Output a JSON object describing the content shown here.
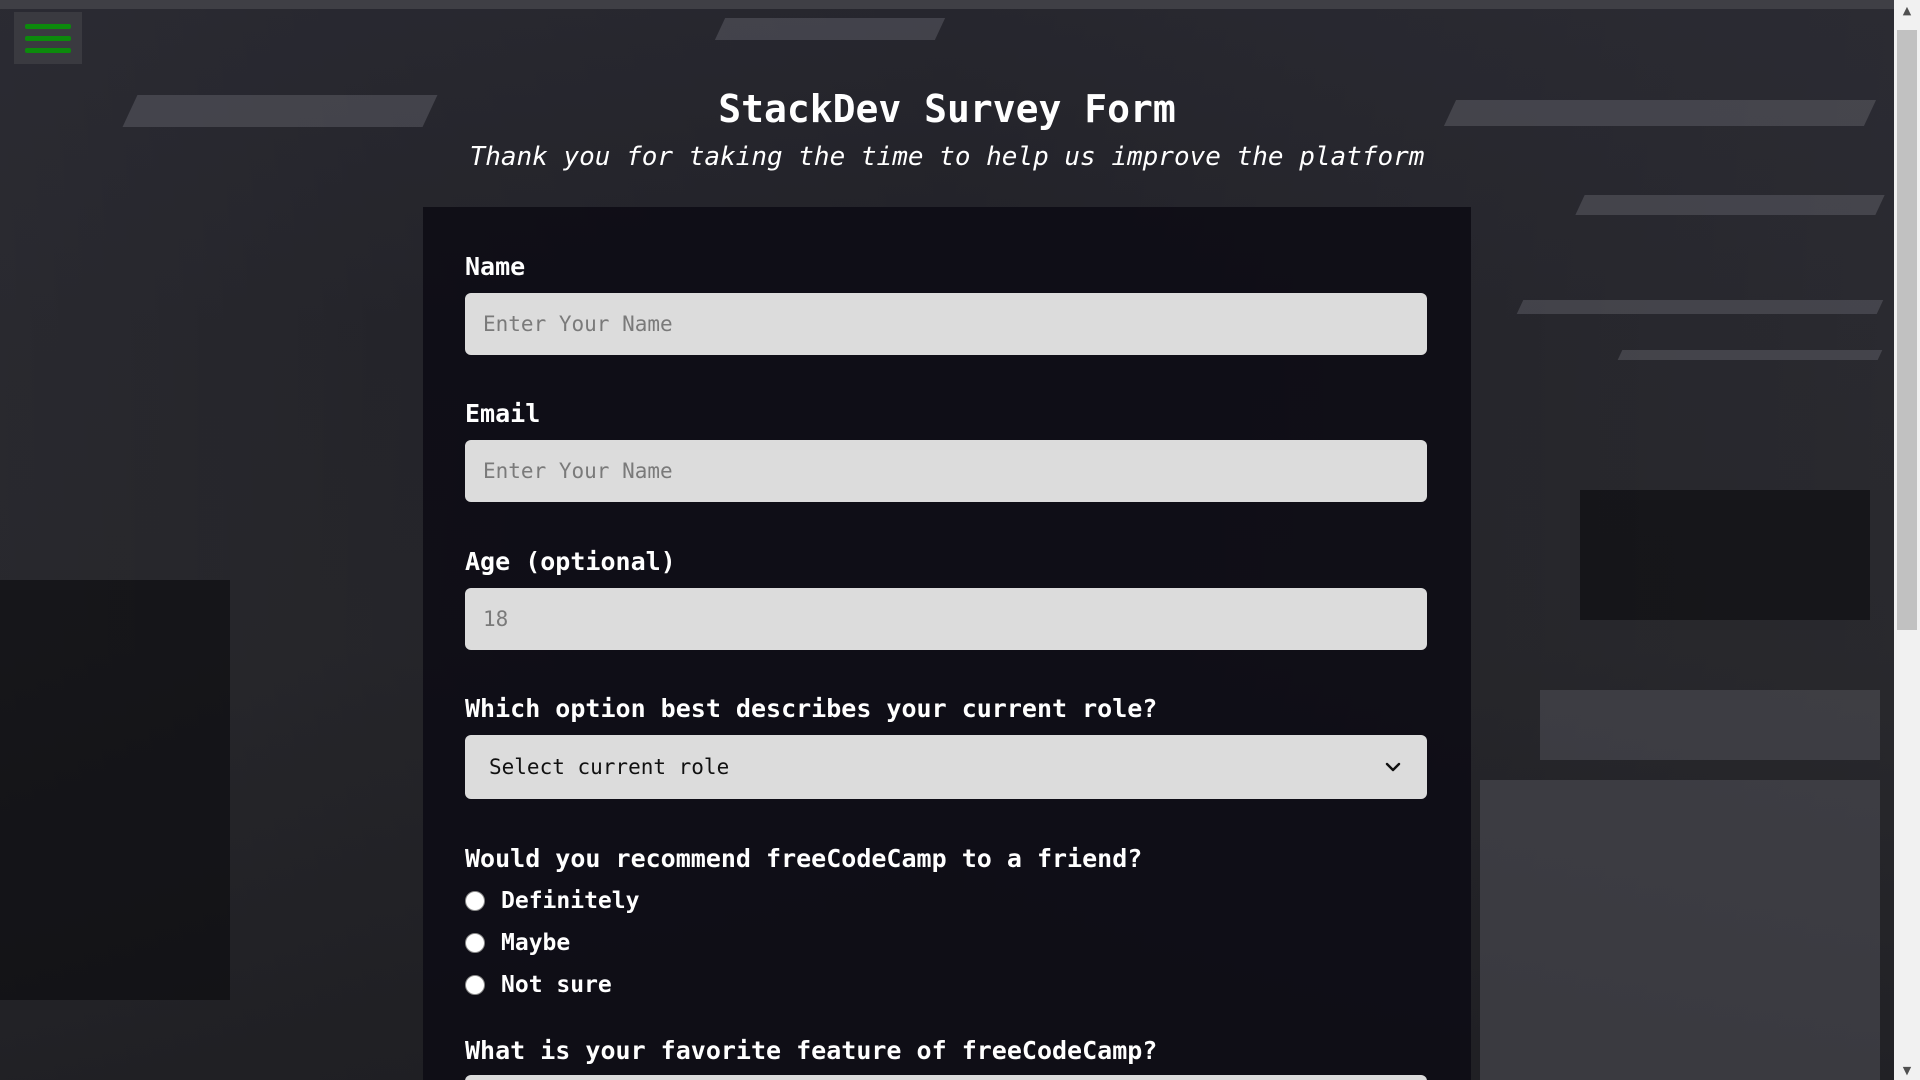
{
  "header": {
    "title": "StackDev Survey Form",
    "subtitle": "Thank you for taking the time to help us improve the platform"
  },
  "menu": {
    "icon": "hamburger-icon",
    "icon_color": "#0c8a0c"
  },
  "form": {
    "name": {
      "label": "Name",
      "placeholder": "Enter Your Name",
      "value": ""
    },
    "email": {
      "label": "Email",
      "placeholder": "Enter Your Name",
      "value": ""
    },
    "age": {
      "label": "Age (optional)",
      "placeholder": "18",
      "value": ""
    },
    "role": {
      "label": "Which option best describes your current role?",
      "selected": "Select current role"
    },
    "recommend": {
      "label": "Would you recommend freeCodeCamp to a friend?",
      "options": [
        {
          "label": "Definitely",
          "checked": false
        },
        {
          "label": "Maybe",
          "checked": false
        },
        {
          "label": "Not sure",
          "checked": false
        }
      ]
    },
    "favorite_feature": {
      "label": "What is your favorite feature of freeCodeCamp?"
    }
  },
  "colors": {
    "panel_bg": "#0e0d16",
    "input_bg": "#dcdcdc",
    "text": "#ffffff",
    "accent": "#0c8a0c"
  }
}
